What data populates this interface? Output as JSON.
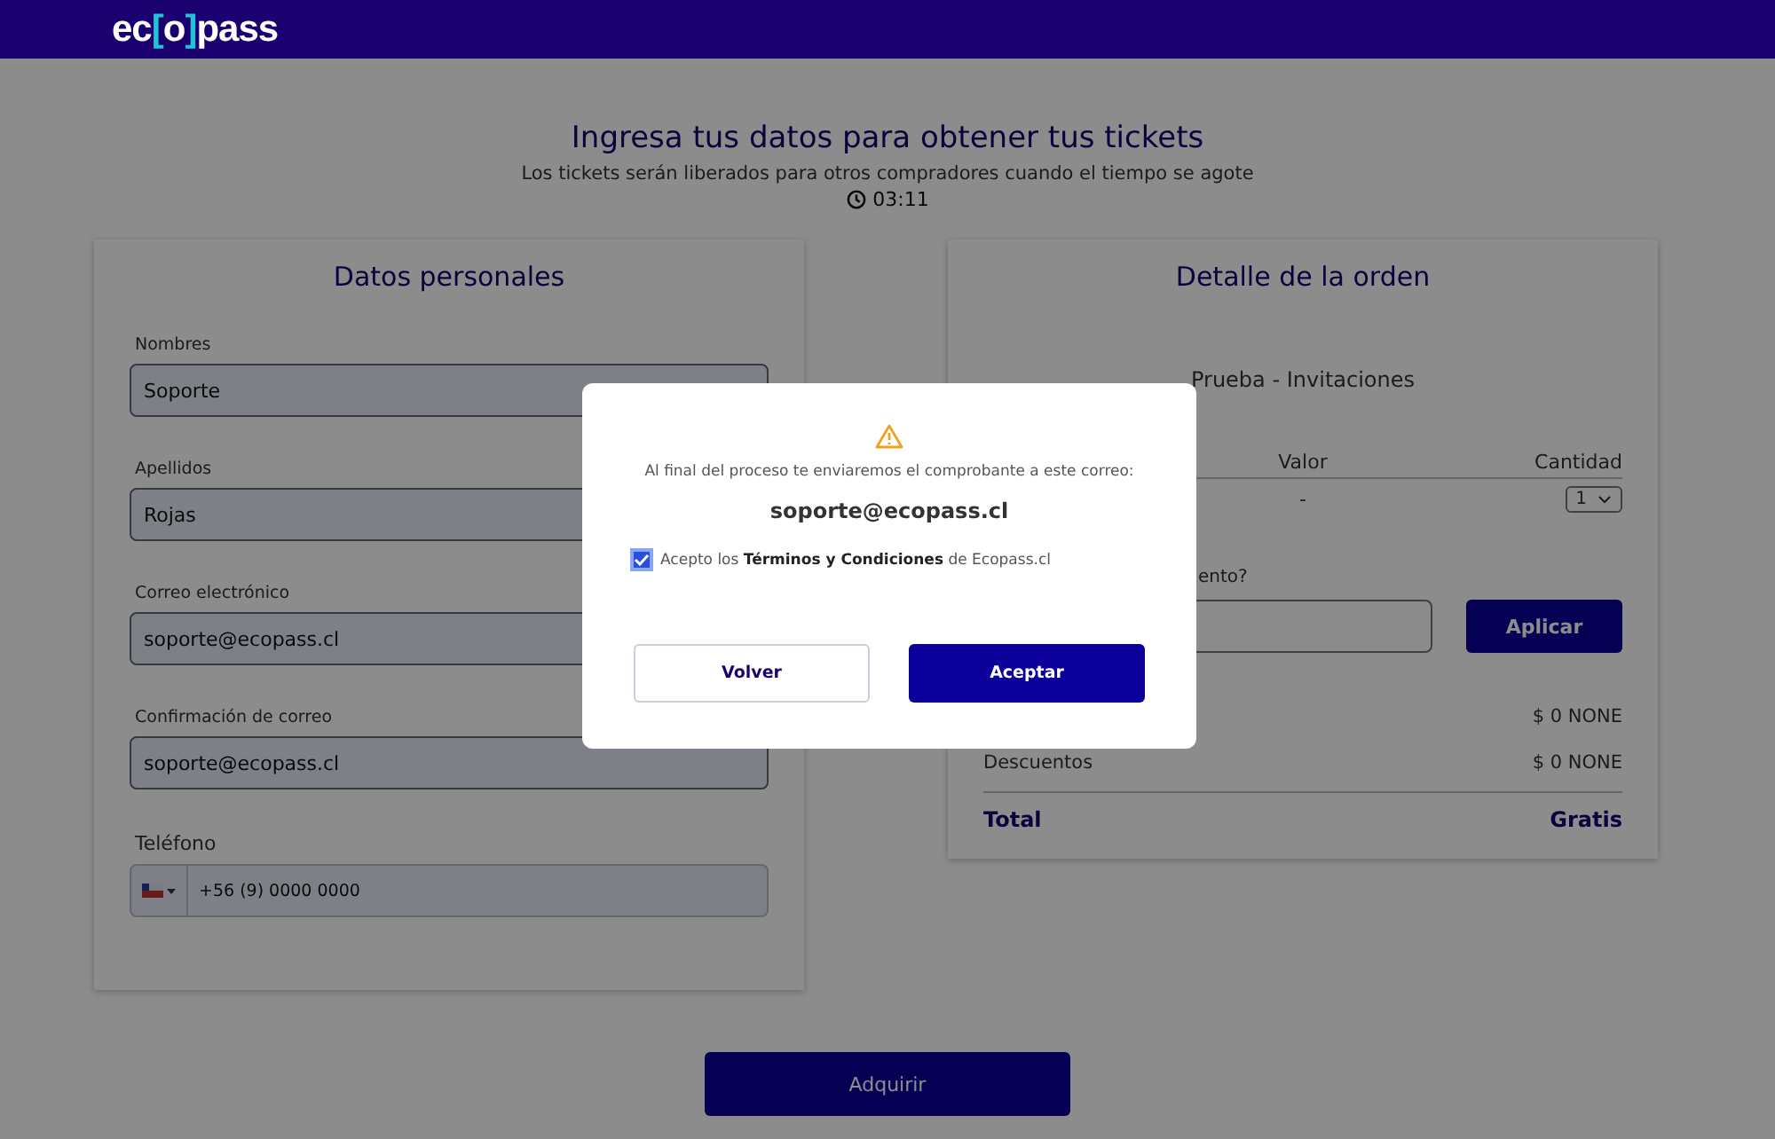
{
  "header": {
    "logo_parts": [
      {
        "text": "ec",
        "accent": false
      },
      {
        "text": "[",
        "accent": true
      },
      {
        "text": "o",
        "accent": false
      },
      {
        "text": "]",
        "accent": true
      },
      {
        "text": "pass",
        "accent": false
      }
    ]
  },
  "page": {
    "title": "Ingresa tus datos para obtener tus tickets",
    "subtitle": "Los tickets serán liberados para otros compradores cuando el tiempo se agote",
    "timer": "03:11"
  },
  "personal": {
    "title": "Datos personales",
    "fields": [
      {
        "label": "Nombres",
        "value": "Soporte",
        "kind": "text"
      },
      {
        "label": "Apellidos",
        "value": "Rojas",
        "kind": "text"
      },
      {
        "label": "Correo electrónico",
        "value": "soporte@ecopass.cl",
        "kind": "text"
      },
      {
        "label": "Confirmación de correo",
        "value": "soporte@ecopass.cl",
        "kind": "text"
      },
      {
        "label": "Teléfono",
        "placeholder": "+56 (9) 0000 0000",
        "kind": "phone"
      }
    ]
  },
  "order": {
    "title": "Detalle de la orden",
    "event": "Prueba - Invitaciones",
    "columns": [
      "Valor",
      "Cantidad"
    ],
    "ticket": {
      "value": "-",
      "quantity": "1"
    },
    "discount_label": "ento?",
    "apply_button": "Aplicar",
    "summary": [
      {
        "amount": "$ 0 NONE"
      },
      {
        "label": "Descuentos",
        "amount": "$ 0 NONE"
      }
    ],
    "total_label": "Total",
    "total_value": "Gratis"
  },
  "buy_button": "Adquirir",
  "modal": {
    "message": "Al final del proceso te enviaremos el comprobante a este correo:",
    "email": "soporte@ecopass.cl",
    "terms": {
      "checked": true,
      "text": "Acepto los **Términos y Condiciones** de Ecopass.cl"
    },
    "buttons": [
      {
        "label": "Volver",
        "kind": "secondary"
      },
      {
        "label": "Aceptar",
        "kind": "primary"
      }
    ]
  }
}
